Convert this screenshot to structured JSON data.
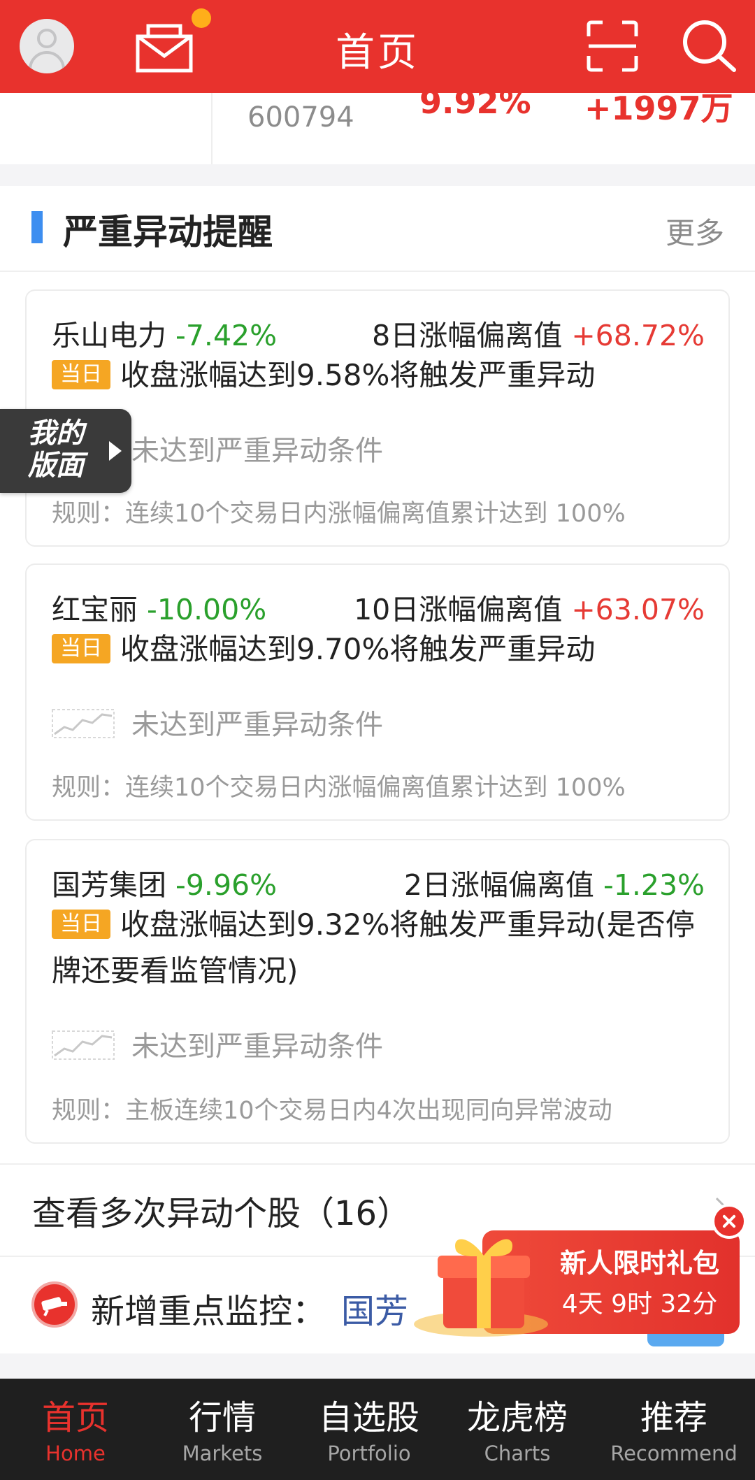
{
  "header": {
    "title": "首页",
    "colors": {
      "bar": "#e8322d",
      "badge": "#ffae1a"
    },
    "icons": [
      "avatar",
      "mail-icon",
      "scan-icon",
      "search-icon"
    ]
  },
  "prev_item": {
    "code": "600794",
    "pct": "9.92%",
    "amount": "+1997万"
  },
  "alert_section": {
    "title": "严重异动提醒",
    "more_label": "更多",
    "cards": [
      {
        "name": "乐山电力",
        "pct": "-7.42%",
        "deviation_label": "8日涨幅偏离值",
        "deviation_value": "+68.72%",
        "badge": "当日",
        "trigger_text": "收盘涨幅达到9.58%将触发严重异动",
        "status": "未达到严重异动条件",
        "rule": "规则：连续10个交易日内涨幅偏离值累计达到 100%"
      },
      {
        "name": "红宝丽",
        "pct": "-10.00%",
        "deviation_label": "10日涨幅偏离值",
        "deviation_value": "+63.07%",
        "badge": "当日",
        "trigger_text": "收盘涨幅达到9.70%将触发严重异动",
        "status": "未达到严重异动条件",
        "rule": "规则：连续10个交易日内涨幅偏离值累计达到 100%"
      },
      {
        "name": "国芳集团",
        "pct": "-9.96%",
        "deviation_label": "2日涨幅偏离值",
        "deviation_value": "-1.23%",
        "badge": "当日",
        "trigger_text": "收盘涨幅达到9.32%将触发严重异动(是否停牌还要看监管情况)",
        "status": "未达到严重异动条件",
        "rule": "规则：主板连续10个交易日内4次出现同向异常波动"
      }
    ]
  },
  "floating_tab": {
    "label": "我的版面"
  },
  "view_more": {
    "label": "查看多次异动个股（16）"
  },
  "monitor": {
    "label": "新增重点监控：",
    "value": "国芳"
  },
  "gift_popup": {
    "title": "新人限时礼包",
    "countdown": "4天 9时 32分"
  },
  "tabbar": [
    {
      "cn": "首页",
      "en": "Home",
      "active": true
    },
    {
      "cn": "行情",
      "en": "Markets",
      "active": false
    },
    {
      "cn": "自选股",
      "en": "Portfolio",
      "active": false
    },
    {
      "cn": "龙虎榜",
      "en": "Charts",
      "active": false
    },
    {
      "cn": "推荐",
      "en": "Recommend",
      "active": false
    }
  ]
}
